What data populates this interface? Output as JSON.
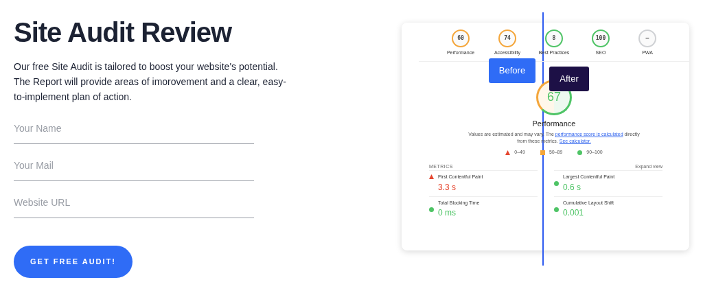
{
  "heading": "Site Audit Review",
  "intro": "Our free Site Audit is tailored to boost your website's potential. The Report will provide areas of imorovement and a clear, easy-to-implement plan of action.",
  "fields": [
    {
      "placeholder": "Your Name"
    },
    {
      "placeholder": "Your Mail"
    },
    {
      "placeholder": "Website URL"
    }
  ],
  "submit_button": "GET FREE AUDIT!",
  "comparison": {
    "before_label": "Before",
    "after_label": "After",
    "categories": [
      {
        "score": "60",
        "label": "Performance",
        "color": "#f4a63b"
      },
      {
        "score": "74",
        "label": "Accessibility",
        "color": "#f4a63b"
      },
      {
        "score": "8",
        "label": "Best Practices",
        "color": "#4fc466"
      },
      {
        "score": "100",
        "label": "SEO",
        "color": "#4fc466"
      },
      {
        "score": "—",
        "label": "PWA",
        "color": "#cfd1d4"
      }
    ],
    "main_gauge": {
      "score": "67",
      "title": "Performance"
    },
    "description": [
      {
        "kind": "text",
        "text": "Values are estimated and may vary. The "
      },
      {
        "kind": "link",
        "text": "performance score is calculated"
      },
      {
        "kind": "text",
        "text": " directly from these metrics. "
      },
      {
        "kind": "link",
        "text": "See calculator."
      }
    ],
    "legend": [
      {
        "kind": "fail",
        "text": "0–49"
      },
      {
        "kind": "average",
        "text": "50–89"
      },
      {
        "kind": "pass",
        "text": "90–100"
      }
    ],
    "metrics_title": "METRICS",
    "expand_link": "Expand view",
    "metrics": [
      {
        "label": "First Contentful Paint",
        "value": "3.3 s",
        "kind": "fail",
        "color": "#e5462f"
      },
      {
        "label": "Largest Contentful Paint",
        "value": "0.6 s",
        "kind": "pass",
        "color": "#4fc466"
      },
      {
        "label": "Total Blocking Time",
        "value": "0 ms",
        "kind": "pass",
        "color": "#4fc466"
      },
      {
        "label": "Cumulative Layout Shift",
        "value": "0.001",
        "kind": "pass",
        "color": "#4fc466"
      }
    ]
  }
}
